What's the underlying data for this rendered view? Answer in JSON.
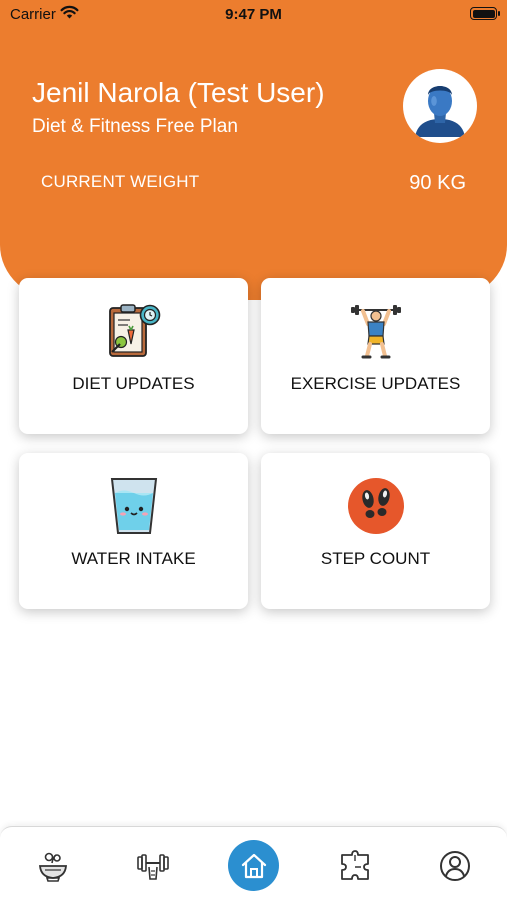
{
  "status_bar": {
    "carrier": "Carrier",
    "time": "9:47 PM"
  },
  "profile": {
    "name": "Jenil Narola (Test User)",
    "plan": "Diet & Fitness Free Plan",
    "weight_label": "CURRENT WEIGHT",
    "weight_value": "90 KG",
    "avatar_icon": "user-avatar-icon"
  },
  "cards": [
    {
      "label": "DIET UPDATES",
      "icon": "diet-clipboard-icon"
    },
    {
      "label": "EXERCISE UPDATES",
      "icon": "weightlifter-icon"
    },
    {
      "label": "WATER INTAKE",
      "icon": "water-glass-icon"
    },
    {
      "label": "STEP COUNT",
      "icon": "footsteps-icon"
    }
  ],
  "tab_bar": {
    "tabs": [
      {
        "icon": "food-bowl-icon",
        "active": false
      },
      {
        "icon": "dumbbell-icon",
        "active": false
      },
      {
        "icon": "home-icon",
        "active": true
      },
      {
        "icon": "puzzle-icon",
        "active": false
      },
      {
        "icon": "profile-icon",
        "active": false
      }
    ]
  },
  "colors": {
    "header": "#ec7d2e",
    "accent": "#2b8fd0",
    "step_icon_bg": "#e6572b"
  }
}
